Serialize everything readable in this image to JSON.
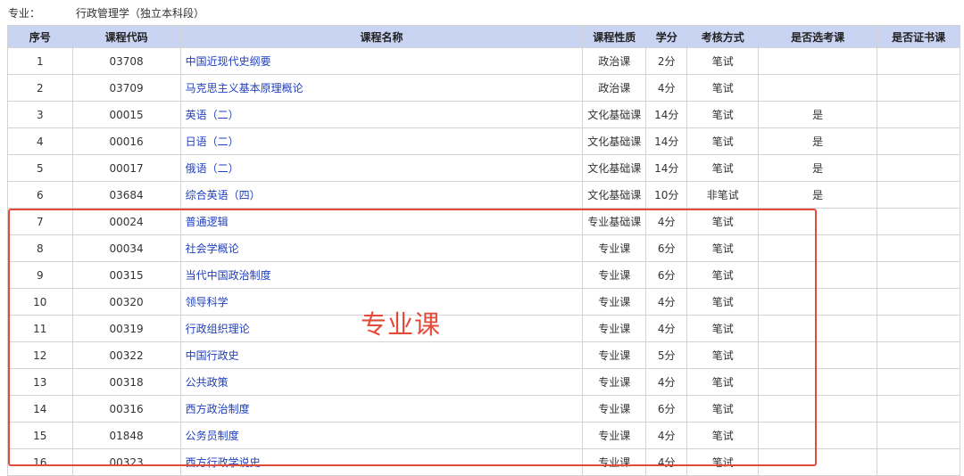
{
  "major": {
    "label": "专业：",
    "value": "行政管理学（独立本科段）"
  },
  "table": {
    "headers": [
      "序号",
      "课程代码",
      "课程名称",
      "课程性质",
      "学分",
      "考核方式",
      "是否选考课",
      "是否证书课"
    ],
    "rows": [
      {
        "no": "1",
        "code": "03708",
        "name": "中国近现代史纲要",
        "type": "政治课",
        "credit": "2分",
        "exam": "笔试",
        "elective": "",
        "cert": ""
      },
      {
        "no": "2",
        "code": "03709",
        "name": "马克思主义基本原理概论",
        "type": "政治课",
        "credit": "4分",
        "exam": "笔试",
        "elective": "",
        "cert": ""
      },
      {
        "no": "3",
        "code": "00015",
        "name": "英语（二）",
        "type": "文化基础课",
        "credit": "14分",
        "exam": "笔试",
        "elective": "是",
        "cert": ""
      },
      {
        "no": "4",
        "code": "00016",
        "name": "日语（二）",
        "type": "文化基础课",
        "credit": "14分",
        "exam": "笔试",
        "elective": "是",
        "cert": ""
      },
      {
        "no": "5",
        "code": "00017",
        "name": "俄语（二）",
        "type": "文化基础课",
        "credit": "14分",
        "exam": "笔试",
        "elective": "是",
        "cert": ""
      },
      {
        "no": "6",
        "code": "03684",
        "name": "综合英语（四）",
        "type": "文化基础课",
        "credit": "10分",
        "exam": "非笔试",
        "elective": "是",
        "cert": ""
      },
      {
        "no": "7",
        "code": "00024",
        "name": "普通逻辑",
        "type": "专业基础课",
        "credit": "4分",
        "exam": "笔试",
        "elective": "",
        "cert": ""
      },
      {
        "no": "8",
        "code": "00034",
        "name": "社会学概论",
        "type": "专业课",
        "credit": "6分",
        "exam": "笔试",
        "elective": "",
        "cert": ""
      },
      {
        "no": "9",
        "code": "00315",
        "name": "当代中国政治制度",
        "type": "专业课",
        "credit": "6分",
        "exam": "笔试",
        "elective": "",
        "cert": ""
      },
      {
        "no": "10",
        "code": "00320",
        "name": "领导科学",
        "type": "专业课",
        "credit": "4分",
        "exam": "笔试",
        "elective": "",
        "cert": ""
      },
      {
        "no": "11",
        "code": "00319",
        "name": "行政组织理论",
        "type": "专业课",
        "credit": "4分",
        "exam": "笔试",
        "elective": "",
        "cert": ""
      },
      {
        "no": "12",
        "code": "00322",
        "name": "中国行政史",
        "type": "专业课",
        "credit": "5分",
        "exam": "笔试",
        "elective": "",
        "cert": ""
      },
      {
        "no": "13",
        "code": "00318",
        "name": "公共政策",
        "type": "专业课",
        "credit": "4分",
        "exam": "笔试",
        "elective": "",
        "cert": ""
      },
      {
        "no": "14",
        "code": "00316",
        "name": "西方政治制度",
        "type": "专业课",
        "credit": "6分",
        "exam": "笔试",
        "elective": "",
        "cert": ""
      },
      {
        "no": "15",
        "code": "01848",
        "name": "公务员制度",
        "type": "专业课",
        "credit": "4分",
        "exam": "笔试",
        "elective": "",
        "cert": ""
      },
      {
        "no": "16",
        "code": "00323",
        "name": "西方行政学说史",
        "type": "专业课",
        "credit": "4分",
        "exam": "笔试",
        "elective": "",
        "cert": ""
      }
    ]
  },
  "annotation": {
    "text": "专业课",
    "color": "#e24b3a"
  },
  "colors": {
    "header_bg": "#c9d3f2",
    "link": "#1f3fbf",
    "border": "#d3d3d3"
  }
}
